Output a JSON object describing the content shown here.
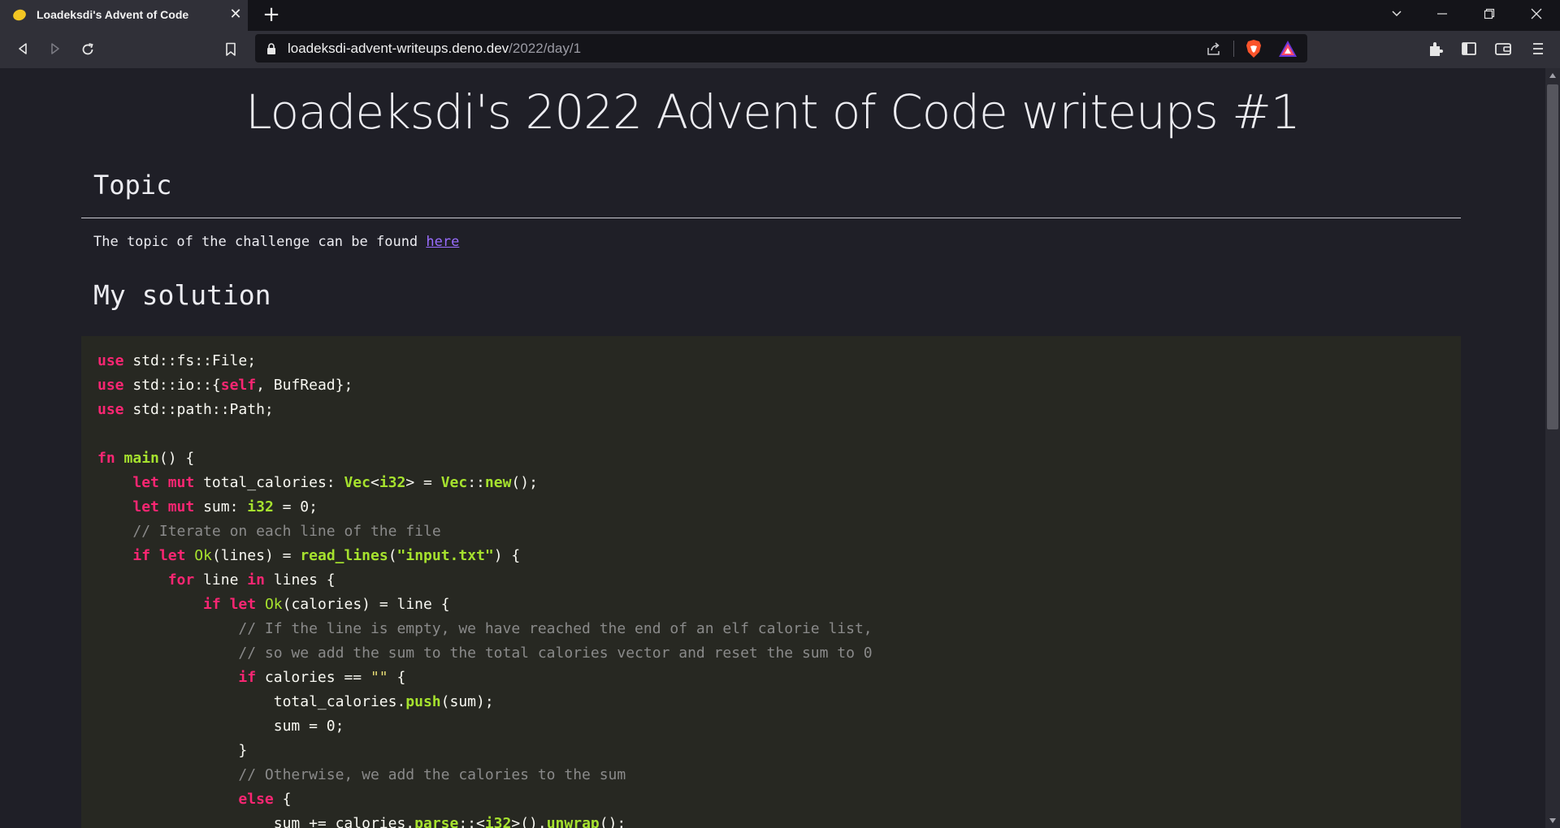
{
  "browser": {
    "tab_title": "Loadeksdi's Advent of Code",
    "url_host": "loadeksdi-advent-writeups.deno.dev",
    "url_path": "/2022/day/1"
  },
  "page": {
    "title": "Loadeksdi's 2022 Advent of Code writeups #1",
    "topic_heading": "Topic",
    "topic_text": "The topic of the challenge can be found ",
    "topic_link": "here",
    "solution_heading": "My solution"
  },
  "code": {
    "language": "rust",
    "lines": [
      "use std::fs::File;",
      "use std::io::{self, BufRead};",
      "use std::path::Path;",
      "",
      "fn main() {",
      "    let mut total_calories: Vec<i32> = Vec::new();",
      "    let mut sum: i32 = 0;",
      "    // Iterate on each line of the file",
      "    if let Ok(lines) = read_lines(\"input.txt\") {",
      "        for line in lines {",
      "            if let Ok(calories) = line {",
      "                // If the line is empty, we have reached the end of an elf calorie list,",
      "                // so we add the sum to the total calories vector and reset the sum to 0",
      "                if calories == \"\" {",
      "                    total_calories.push(sum);",
      "                    sum = 0;",
      "                }",
      "                // Otherwise, we add the calories to the sum",
      "                else {",
      "                    sum += calories.parse::<i32>().unwrap();"
    ]
  }
}
